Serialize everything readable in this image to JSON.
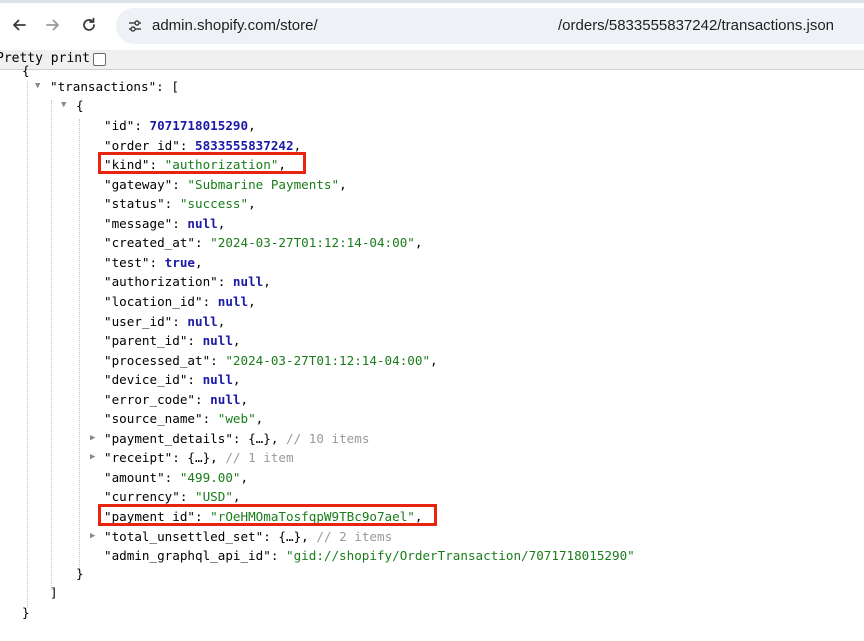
{
  "browser": {
    "back_icon": "back-arrow-icon",
    "forward_icon": "forward-arrow-icon",
    "reload_icon": "reload-icon",
    "site_icon": "site-settings-icon",
    "url_left": "admin.shopify.com/store/",
    "url_right": "/orders/5833555837242/transactions.json"
  },
  "viewer": {
    "pretty_print_label": "Pretty print",
    "pretty_print_checked": false
  },
  "json": {
    "open_brace": "{",
    "transactions_key": "\"transactions\"",
    "colon_bracket": ": [",
    "item_open": "{",
    "fields": [
      {
        "key": "\"id\"",
        "sep": ": ",
        "value": "7071718015290",
        "type": "num",
        "trail": ","
      },
      {
        "key": "\"order_id\"",
        "sep": ": ",
        "value": "5833555837242",
        "type": "num",
        "trail": ","
      },
      {
        "key": "\"kind\"",
        "sep": ": ",
        "value": "\"authorization\"",
        "type": "str",
        "trail": ","
      },
      {
        "key": "\"gateway\"",
        "sep": ": ",
        "value": "\"Submarine Payments\"",
        "type": "str",
        "trail": ","
      },
      {
        "key": "\"status\"",
        "sep": ": ",
        "value": "\"success\"",
        "type": "str",
        "trail": ","
      },
      {
        "key": "\"message\"",
        "sep": ": ",
        "value": "null",
        "type": "lit",
        "trail": ","
      },
      {
        "key": "\"created_at\"",
        "sep": ": ",
        "value": "\"2024-03-27T01:12:14-04:00\"",
        "type": "str",
        "trail": ","
      },
      {
        "key": "\"test\"",
        "sep": ": ",
        "value": "true",
        "type": "lit",
        "trail": ","
      },
      {
        "key": "\"authorization\"",
        "sep": ": ",
        "value": "null",
        "type": "lit",
        "trail": ","
      },
      {
        "key": "\"location_id\"",
        "sep": ": ",
        "value": "null",
        "type": "lit",
        "trail": ","
      },
      {
        "key": "\"user_id\"",
        "sep": ": ",
        "value": "null",
        "type": "lit",
        "trail": ","
      },
      {
        "key": "\"parent_id\"",
        "sep": ": ",
        "value": "null",
        "type": "lit",
        "trail": ","
      },
      {
        "key": "\"processed_at\"",
        "sep": ": ",
        "value": "\"2024-03-27T01:12:14-04:00\"",
        "type": "str",
        "trail": ","
      },
      {
        "key": "\"device_id\"",
        "sep": ": ",
        "value": "null",
        "type": "lit",
        "trail": ","
      },
      {
        "key": "\"error_code\"",
        "sep": ": ",
        "value": "null",
        "type": "lit",
        "trail": ","
      },
      {
        "key": "\"source_name\"",
        "sep": ": ",
        "value": "\"web\"",
        "type": "str",
        "trail": ","
      },
      {
        "key": "\"payment_details\"",
        "sep": ": ",
        "value": "{…},",
        "type": "collapsed",
        "comment": " // 10 items"
      },
      {
        "key": "\"receipt\"",
        "sep": ": ",
        "value": "{…},",
        "type": "collapsed",
        "comment": " // 1 item"
      },
      {
        "key": "\"amount\"",
        "sep": ": ",
        "value": "\"499.00\"",
        "type": "str",
        "trail": ","
      },
      {
        "key": "\"currency\"",
        "sep": ": ",
        "value": "\"USD\"",
        "type": "str",
        "trail": ","
      },
      {
        "key": "\"payment_id\"",
        "sep": ": ",
        "value": "\"rOeHMOmaTosfqpW9TBc9o7ael\"",
        "type": "str",
        "trail": ","
      },
      {
        "key": "\"total_unsettled_set\"",
        "sep": ": ",
        "value": "{…},",
        "type": "collapsed",
        "comment": " // 2 items"
      },
      {
        "key": "\"admin_graphql_api_id\"",
        "sep": ": ",
        "value": "\"gid://shopify/OrderTransaction/7071718015290\"",
        "type": "str",
        "trail": ""
      }
    ],
    "item_close": "}",
    "array_close": "]",
    "close_brace": "}"
  },
  "highlight_color": "#e8230f"
}
